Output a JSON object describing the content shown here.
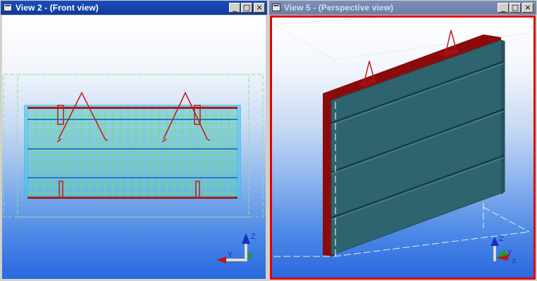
{
  "windows": [
    {
      "title": "View 2 - (Front view)",
      "active": true
    },
    {
      "title": "View 5 - (Perspective view)",
      "active": false
    }
  ],
  "controls": {
    "minimize": "_",
    "maximize": "□",
    "close": "×"
  },
  "axes": {
    "x": "X",
    "y": "Y",
    "z": "Z"
  },
  "colors": {
    "title_active": "#1b4db8",
    "title_inactive": "#7c8fb8",
    "selection_border": "#e00000",
    "panel_fill": "#2e6470",
    "steel_red": "#8b0b0b",
    "grid_green": "#6fe06f",
    "outline_cyan": "#2cc4e8"
  }
}
